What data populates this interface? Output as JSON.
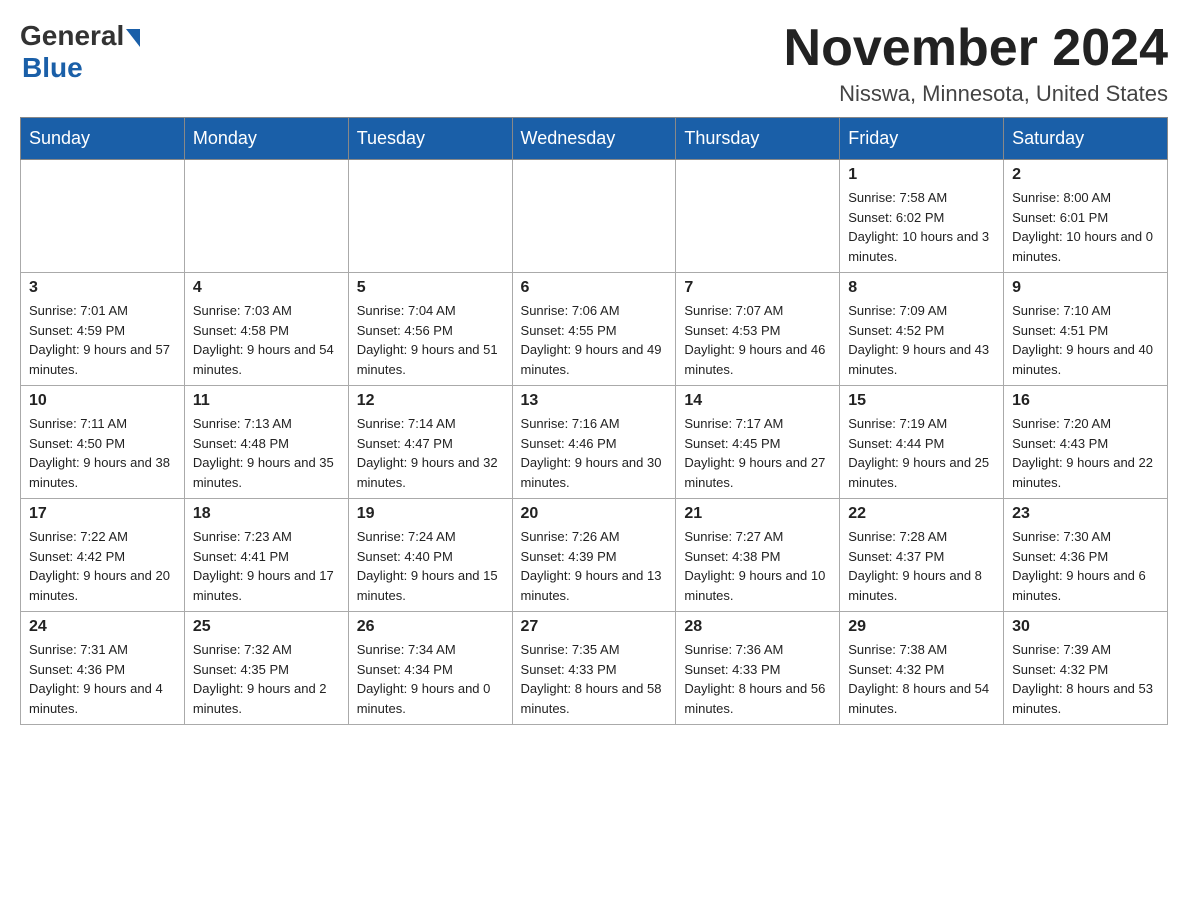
{
  "header": {
    "logo_general": "General",
    "logo_blue": "Blue",
    "month_title": "November 2024",
    "location": "Nisswa, Minnesota, United States"
  },
  "days_of_week": [
    "Sunday",
    "Monday",
    "Tuesday",
    "Wednesday",
    "Thursday",
    "Friday",
    "Saturday"
  ],
  "weeks": [
    [
      {
        "day": "",
        "info": ""
      },
      {
        "day": "",
        "info": ""
      },
      {
        "day": "",
        "info": ""
      },
      {
        "day": "",
        "info": ""
      },
      {
        "day": "",
        "info": ""
      },
      {
        "day": "1",
        "info": "Sunrise: 7:58 AM\nSunset: 6:02 PM\nDaylight: 10 hours and 3 minutes."
      },
      {
        "day": "2",
        "info": "Sunrise: 8:00 AM\nSunset: 6:01 PM\nDaylight: 10 hours and 0 minutes."
      }
    ],
    [
      {
        "day": "3",
        "info": "Sunrise: 7:01 AM\nSunset: 4:59 PM\nDaylight: 9 hours and 57 minutes."
      },
      {
        "day": "4",
        "info": "Sunrise: 7:03 AM\nSunset: 4:58 PM\nDaylight: 9 hours and 54 minutes."
      },
      {
        "day": "5",
        "info": "Sunrise: 7:04 AM\nSunset: 4:56 PM\nDaylight: 9 hours and 51 minutes."
      },
      {
        "day": "6",
        "info": "Sunrise: 7:06 AM\nSunset: 4:55 PM\nDaylight: 9 hours and 49 minutes."
      },
      {
        "day": "7",
        "info": "Sunrise: 7:07 AM\nSunset: 4:53 PM\nDaylight: 9 hours and 46 minutes."
      },
      {
        "day": "8",
        "info": "Sunrise: 7:09 AM\nSunset: 4:52 PM\nDaylight: 9 hours and 43 minutes."
      },
      {
        "day": "9",
        "info": "Sunrise: 7:10 AM\nSunset: 4:51 PM\nDaylight: 9 hours and 40 minutes."
      }
    ],
    [
      {
        "day": "10",
        "info": "Sunrise: 7:11 AM\nSunset: 4:50 PM\nDaylight: 9 hours and 38 minutes."
      },
      {
        "day": "11",
        "info": "Sunrise: 7:13 AM\nSunset: 4:48 PM\nDaylight: 9 hours and 35 minutes."
      },
      {
        "day": "12",
        "info": "Sunrise: 7:14 AM\nSunset: 4:47 PM\nDaylight: 9 hours and 32 minutes."
      },
      {
        "day": "13",
        "info": "Sunrise: 7:16 AM\nSunset: 4:46 PM\nDaylight: 9 hours and 30 minutes."
      },
      {
        "day": "14",
        "info": "Sunrise: 7:17 AM\nSunset: 4:45 PM\nDaylight: 9 hours and 27 minutes."
      },
      {
        "day": "15",
        "info": "Sunrise: 7:19 AM\nSunset: 4:44 PM\nDaylight: 9 hours and 25 minutes."
      },
      {
        "day": "16",
        "info": "Sunrise: 7:20 AM\nSunset: 4:43 PM\nDaylight: 9 hours and 22 minutes."
      }
    ],
    [
      {
        "day": "17",
        "info": "Sunrise: 7:22 AM\nSunset: 4:42 PM\nDaylight: 9 hours and 20 minutes."
      },
      {
        "day": "18",
        "info": "Sunrise: 7:23 AM\nSunset: 4:41 PM\nDaylight: 9 hours and 17 minutes."
      },
      {
        "day": "19",
        "info": "Sunrise: 7:24 AM\nSunset: 4:40 PM\nDaylight: 9 hours and 15 minutes."
      },
      {
        "day": "20",
        "info": "Sunrise: 7:26 AM\nSunset: 4:39 PM\nDaylight: 9 hours and 13 minutes."
      },
      {
        "day": "21",
        "info": "Sunrise: 7:27 AM\nSunset: 4:38 PM\nDaylight: 9 hours and 10 minutes."
      },
      {
        "day": "22",
        "info": "Sunrise: 7:28 AM\nSunset: 4:37 PM\nDaylight: 9 hours and 8 minutes."
      },
      {
        "day": "23",
        "info": "Sunrise: 7:30 AM\nSunset: 4:36 PM\nDaylight: 9 hours and 6 minutes."
      }
    ],
    [
      {
        "day": "24",
        "info": "Sunrise: 7:31 AM\nSunset: 4:36 PM\nDaylight: 9 hours and 4 minutes."
      },
      {
        "day": "25",
        "info": "Sunrise: 7:32 AM\nSunset: 4:35 PM\nDaylight: 9 hours and 2 minutes."
      },
      {
        "day": "26",
        "info": "Sunrise: 7:34 AM\nSunset: 4:34 PM\nDaylight: 9 hours and 0 minutes."
      },
      {
        "day": "27",
        "info": "Sunrise: 7:35 AM\nSunset: 4:33 PM\nDaylight: 8 hours and 58 minutes."
      },
      {
        "day": "28",
        "info": "Sunrise: 7:36 AM\nSunset: 4:33 PM\nDaylight: 8 hours and 56 minutes."
      },
      {
        "day": "29",
        "info": "Sunrise: 7:38 AM\nSunset: 4:32 PM\nDaylight: 8 hours and 54 minutes."
      },
      {
        "day": "30",
        "info": "Sunrise: 7:39 AM\nSunset: 4:32 PM\nDaylight: 8 hours and 53 minutes."
      }
    ]
  ]
}
